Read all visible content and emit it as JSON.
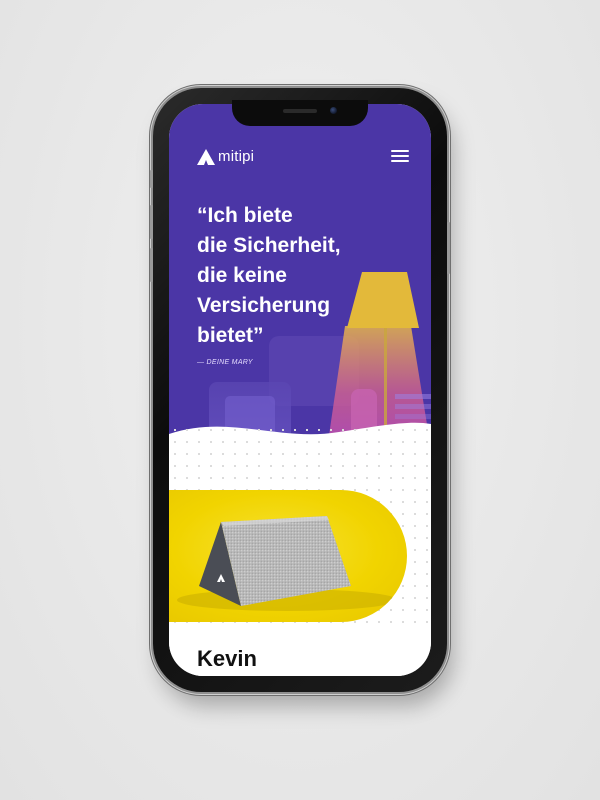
{
  "app": {
    "brand": "mitipi",
    "menu_icon": "hamburger-menu-icon"
  },
  "hero": {
    "quote_lines": [
      "“Ich biete",
      "die Sicherheit,",
      "die keine",
      "Versicherung",
      "bietet”"
    ],
    "attribution": "— DEINE MARY"
  },
  "product": {
    "title": "Kevin",
    "image": "kevin-device-image"
  },
  "colors": {
    "hero_background": "#4b36a6",
    "lamp_yellow": "#e3b93a",
    "product_background": "#f1d400",
    "text_light": "#ffffff",
    "text_dark": "#111111"
  }
}
